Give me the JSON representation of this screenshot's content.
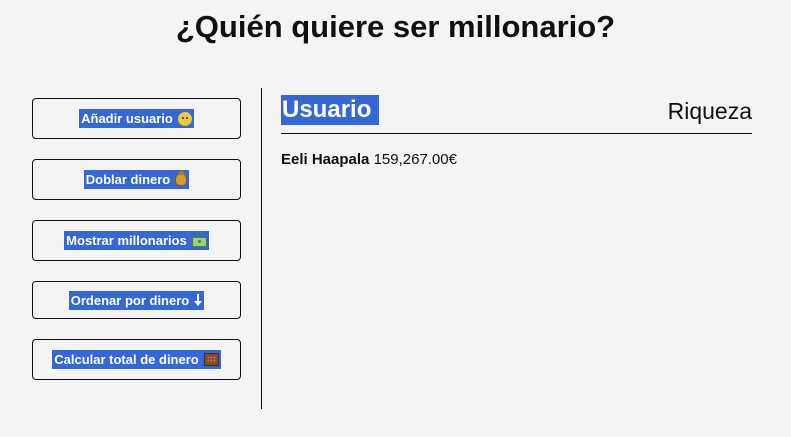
{
  "page": {
    "title": "¿Quién quiere ser millonario?"
  },
  "actions": [
    {
      "label": "Añadir usuario",
      "icon": "baby-face-icon"
    },
    {
      "label": "Doblar dinero",
      "icon": "money-bag-icon"
    },
    {
      "label": "Mostrar millonarios",
      "icon": "banknote-icon"
    },
    {
      "label": "Ordenar por dinero",
      "icon": "down-arrow-icon"
    },
    {
      "label": "Calcular total de dinero",
      "icon": "abacus-icon"
    }
  ],
  "table": {
    "user_header": "Usuario",
    "wealth_header": "Riqueza",
    "rows": [
      {
        "name": "Eeli Haapala",
        "money": "159,267.00€"
      }
    ]
  },
  "colors": {
    "accent": "#3568d4",
    "background": "#f4f4f4",
    "text": "#111111"
  }
}
